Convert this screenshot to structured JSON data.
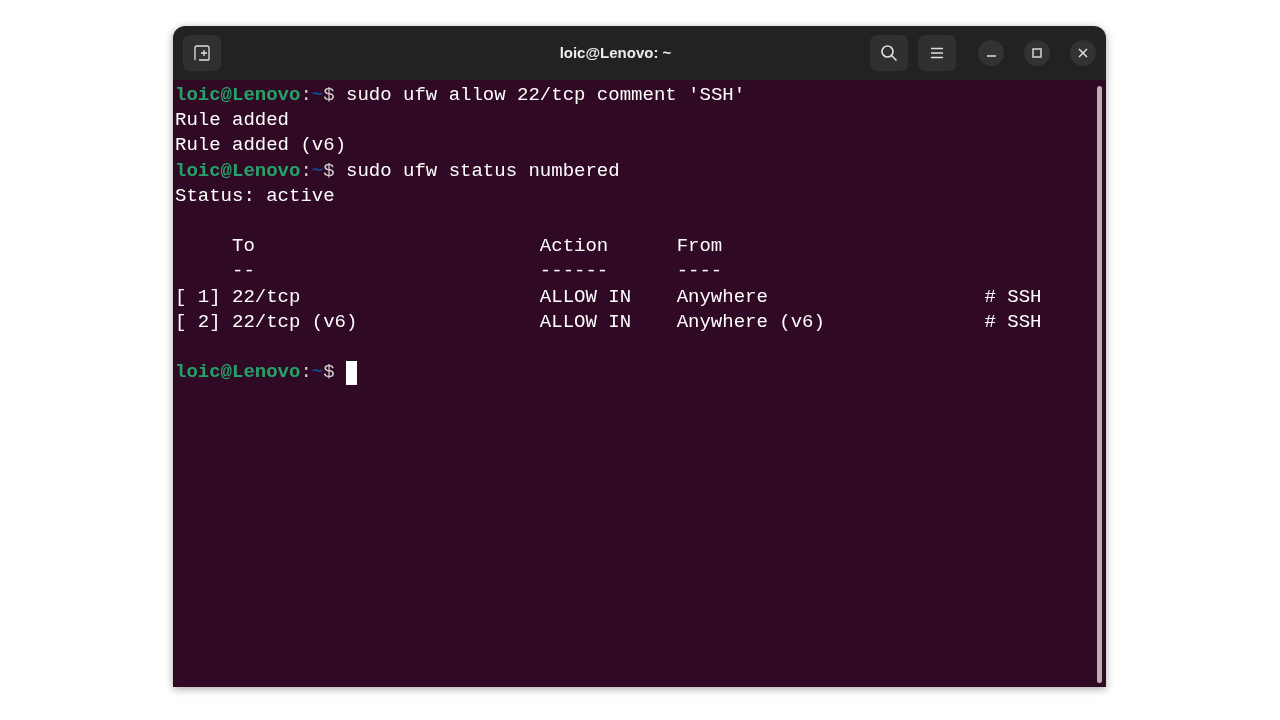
{
  "window": {
    "title": "loic@Lenovo: ~"
  },
  "lines": [
    {
      "kind": "prompt",
      "user": "loic@Lenovo",
      "separator": ":",
      "path": "~",
      "symbol": "$",
      "command": "sudo ufw allow 22/tcp comment 'SSH'",
      "cursor": false
    },
    {
      "kind": "output",
      "text": "Rule added"
    },
    {
      "kind": "output",
      "text": "Rule added (v6)"
    },
    {
      "kind": "prompt",
      "user": "loic@Lenovo",
      "separator": ":",
      "path": "~",
      "symbol": "$",
      "command": "sudo ufw status numbered",
      "cursor": false
    },
    {
      "kind": "output",
      "text": "Status: active"
    },
    {
      "kind": "blank"
    },
    {
      "kind": "table",
      "cells": [
        "",
        "To",
        "Action",
        "From",
        ""
      ]
    },
    {
      "kind": "table",
      "cells": [
        "",
        "--",
        "------",
        "----",
        ""
      ]
    },
    {
      "kind": "table",
      "cells": [
        "[ 1]",
        "22/tcp",
        "ALLOW IN",
        "Anywhere",
        "# SSH"
      ]
    },
    {
      "kind": "table",
      "cells": [
        "[ 2]",
        "22/tcp (v6)",
        "ALLOW IN",
        "Anywhere (v6)",
        "# SSH"
      ]
    },
    {
      "kind": "blank"
    },
    {
      "kind": "prompt",
      "user": "loic@Lenovo",
      "separator": ":",
      "path": "~",
      "symbol": "$",
      "cursor": true
    }
  ]
}
